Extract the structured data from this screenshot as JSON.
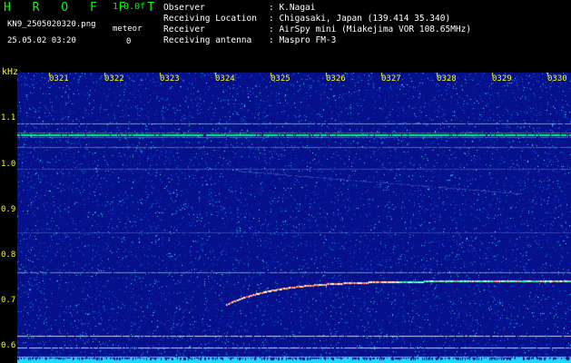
{
  "header": {
    "title": "H R O F F T",
    "version": "1.0.0f",
    "filename": "KN9_2505020320.png",
    "datetime": "25.05.02 03:20",
    "meteor_label": "meteor",
    "meteor_count": "0"
  },
  "info": {
    "observer_label": "Observer",
    "observer_value": ": K.Nagai",
    "location_label": "Receiving Location",
    "location_value": ": Chigasaki, Japan (139.414 35.340)",
    "receiver_label": "Receiver",
    "receiver_value": ": AirSpy mini (Miakejima VOR 108.65MHz)",
    "antenna_label": "Receiving antenna",
    "antenna_value": ": Maspro FM-3"
  },
  "axis": {
    "y_unit": "kHz",
    "y_ticks": [
      "1.1",
      "1.0",
      "0.9",
      "0.8",
      "0.7",
      "0.6"
    ],
    "x_ticks": [
      "0321",
      "0322",
      "0323",
      "0324",
      "0325",
      "0326",
      "0327",
      "0328",
      "0329",
      "0330"
    ]
  },
  "colors": {
    "background": "#05108a",
    "text_green": "#00ff00",
    "text_yellow": "#ffff00",
    "carrier": "#00ff66",
    "grid_lines": "#ffffff"
  }
}
